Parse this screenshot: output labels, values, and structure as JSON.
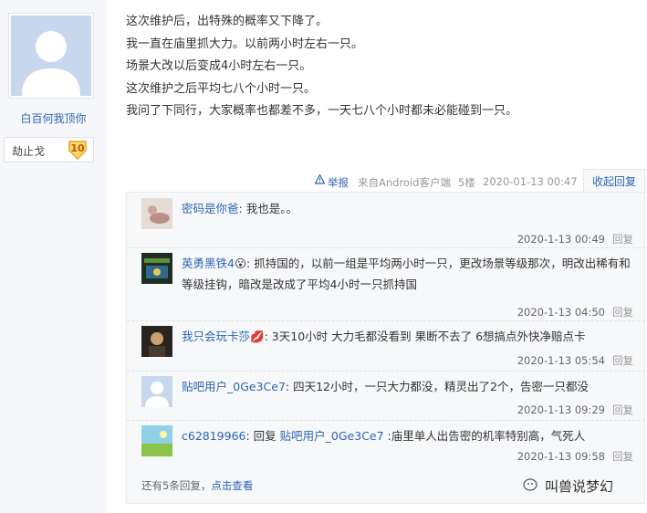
{
  "user": {
    "name": "白百何我顶你",
    "level_name": "劫止戈",
    "level_num": "10"
  },
  "post_lines": [
    "这次维护后，出特殊的概率又下降了。",
    "我一直在庙里抓大力。以前两小时左右一只。",
    "场景大改以后变成4小时左右一只。",
    "这次维护之后平均七八个小时一只。",
    "我问了下同行，大家概率也都差不多，一天七八个小时都未必能碰到一只。"
  ],
  "tail": {
    "report": "举报",
    "client": "来自Android客户端",
    "floor": "5楼",
    "time": "2020-01-13 00:47",
    "collapse": "收起回复"
  },
  "replies": [
    {
      "name": "密码是你爸",
      "emoji": "",
      "prefix": "",
      "target": "",
      "sep": ":",
      "text": "我也是。。",
      "time": "2020-1-13 00:49",
      "reply": "回复"
    },
    {
      "name": "英勇黑铁4",
      "emoji": "😮",
      "prefix": "",
      "target": "",
      "sep": ":",
      "text": "抓持国的，以前一组是平均两小时一只，更改场景等级那次，明改出稀有和等级挂钩，暗改是改成了平均4小时一只抓持国",
      "time": "2020-1-13 04:50",
      "reply": "回复"
    },
    {
      "name": "我只会玩卡莎",
      "emoji": "💋",
      "prefix": "",
      "target": "",
      "sep": ":",
      "text": "3天10小时 大力毛都没看到 果断不去了 6想搞点外快净赔点卡",
      "time": "2020-1-13 05:54",
      "reply": "回复"
    },
    {
      "name": "贴吧用户_0Ge3Ce7",
      "emoji": "",
      "prefix": "",
      "target": "",
      "sep": ":",
      "text": "四天12小时，一只大力都没，精灵出了2个，告密一只都没",
      "time": "2020-1-13 09:29",
      "reply": "回复"
    },
    {
      "name": "c62819966",
      "emoji": "",
      "prefix": ": 回复 ",
      "target": "贴吧用户_0Ge3Ce7",
      "sep": " :",
      "text": "庙里单人出告密的机率特别高，气死人",
      "time": "2020-1-13 09:58",
      "reply": "回复"
    }
  ],
  "more": {
    "count": "还有5条回复",
    "sep": "，",
    "link": "点击查看"
  },
  "watermark": "叫兽说梦幻"
}
